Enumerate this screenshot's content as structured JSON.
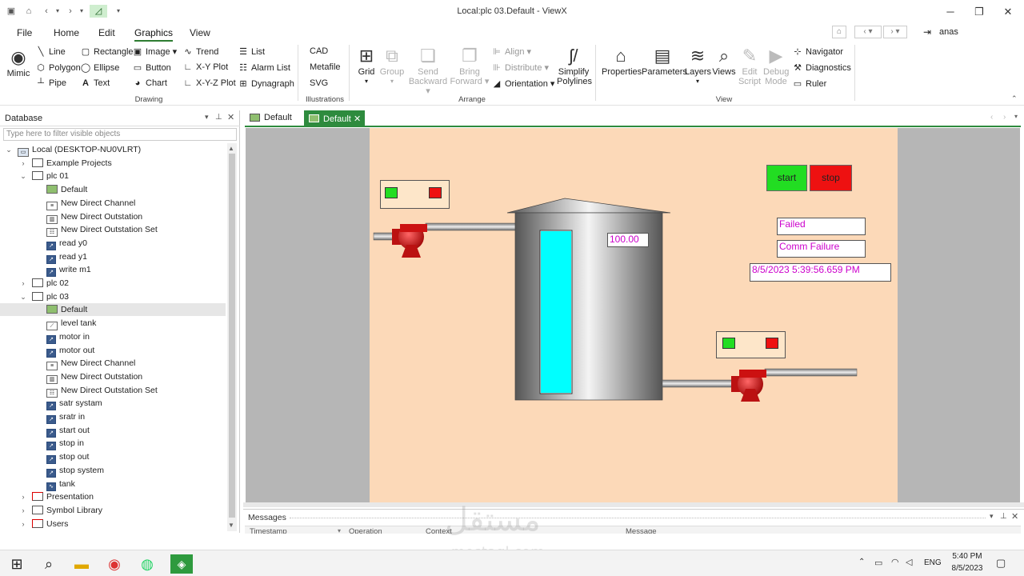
{
  "window": {
    "title": "Local:plc 03.Default - ViewX"
  },
  "menus": [
    "File",
    "Home",
    "Edit",
    "Graphics",
    "View"
  ],
  "active_menu": "Graphics",
  "user": {
    "name": "anas"
  },
  "ribbon": {
    "drawing": {
      "label": "Drawing",
      "mimic": "Mimic",
      "col1": [
        "Line",
        "Polygon",
        "Pipe"
      ],
      "col2": [
        "Rectangle",
        "Ellipse",
        "Text"
      ],
      "col3": [
        "Image",
        "Button",
        "Chart"
      ],
      "col4": [
        "Trend",
        "X-Y Plot",
        "X-Y-Z Plot"
      ],
      "col5": [
        "List",
        "Alarm List",
        "Dynagraph"
      ]
    },
    "illustrations": {
      "label": "Illustrations",
      "items": [
        "CAD",
        "Metafile",
        "SVG"
      ]
    },
    "arrange": {
      "label": "Arrange",
      "grid": "Grid",
      "group": "Group",
      "send_backward": [
        "Send",
        "Backward"
      ],
      "bring_forward": [
        "Bring",
        "Forward"
      ],
      "align": "Align",
      "distribute": "Distribute",
      "orientation": "Orientation",
      "simplify": [
        "Simplify",
        "Polylines"
      ]
    },
    "view": {
      "label": "View",
      "properties": "Properties",
      "parameters": "Parameters",
      "layers": "Layers",
      "views": "Views",
      "edit_script": [
        "Edit",
        "Script"
      ],
      "debug_mode": [
        "Debug",
        "Mode"
      ],
      "navigator": "Navigator",
      "diagnostics": "Diagnostics",
      "ruler": "Ruler"
    }
  },
  "database": {
    "title": "Database",
    "filter_placeholder": "Type here to filter visible objects",
    "tree": [
      {
        "label": "Local (DESKTOP-NU0VLRT)",
        "level": 0,
        "arrow": "down",
        "icon": "pc"
      },
      {
        "label": "Example Projects",
        "level": 1,
        "arrow": "right",
        "icon": "folder"
      },
      {
        "label": "plc 01",
        "level": 1,
        "arrow": "down",
        "icon": "folder"
      },
      {
        "label": "Default",
        "level": 2,
        "icon": "mimic"
      },
      {
        "label": "New Direct Channel",
        "level": 2,
        "icon": "channel"
      },
      {
        "label": "New Direct Outstation",
        "level": 2,
        "icon": "outstation"
      },
      {
        "label": "New Direct Outstation Set",
        "level": 2,
        "icon": "set"
      },
      {
        "label": "read y0",
        "level": 2,
        "icon": "point"
      },
      {
        "label": "read y1",
        "level": 2,
        "icon": "point"
      },
      {
        "label": "write m1",
        "level": 2,
        "icon": "point"
      },
      {
        "label": "plc 02",
        "level": 1,
        "arrow": "right",
        "icon": "folder"
      },
      {
        "label": "plc 03",
        "level": 1,
        "arrow": "down",
        "icon": "folder"
      },
      {
        "label": "Default",
        "level": 2,
        "icon": "mimic",
        "selected": true
      },
      {
        "label": "level tank",
        "level": 2,
        "icon": "trend"
      },
      {
        "label": "motor in",
        "level": 2,
        "icon": "point"
      },
      {
        "label": "motor out",
        "level": 2,
        "icon": "point"
      },
      {
        "label": "New Direct Channel",
        "level": 2,
        "icon": "channel"
      },
      {
        "label": "New Direct Outstation",
        "level": 2,
        "icon": "outstation"
      },
      {
        "label": "New Direct Outstation Set",
        "level": 2,
        "icon": "set"
      },
      {
        "label": "satr systam",
        "level": 2,
        "icon": "point"
      },
      {
        "label": "sratr in",
        "level": 2,
        "icon": "point"
      },
      {
        "label": "start out",
        "level": 2,
        "icon": "point"
      },
      {
        "label": "stop in",
        "level": 2,
        "icon": "point"
      },
      {
        "label": "stop out",
        "level": 2,
        "icon": "point"
      },
      {
        "label": "stop system",
        "level": 2,
        "icon": "point"
      },
      {
        "label": "tank",
        "level": 2,
        "icon": "analog"
      },
      {
        "label": "Presentation",
        "level": 1,
        "arrow": "right",
        "icon": "folder-x"
      },
      {
        "label": "Symbol Library",
        "level": 1,
        "arrow": "right",
        "icon": "folder"
      },
      {
        "label": "Users",
        "level": 1,
        "arrow": "right",
        "icon": "folder-x"
      }
    ]
  },
  "tabs": [
    {
      "label": "Default",
      "active": false
    },
    {
      "label": "Default",
      "active": true
    }
  ],
  "mimic": {
    "start_label": "start",
    "stop_label": "stop",
    "status_text": "Failed",
    "comm_text": "Comm Failure",
    "timestamp": "8/5/2023 5:39:56.659 PM",
    "tank_value": "100.00",
    "tank_level_fraction": 1.0,
    "colors": {
      "background": "#fcd9b8",
      "green": "#22dd22",
      "red": "#ee1111",
      "text": "#cc00cc",
      "liquid": "#00ffff"
    }
  },
  "messages": {
    "title": "Messages",
    "columns": [
      "Timestamp",
      "Operation",
      "Context",
      "Message"
    ]
  },
  "watermark": {
    "arabic": "مستقل",
    "latin": "mostaql.com"
  },
  "taskbar": {
    "language": "ENG",
    "time": "5:40 PM",
    "date": "8/5/2023"
  }
}
